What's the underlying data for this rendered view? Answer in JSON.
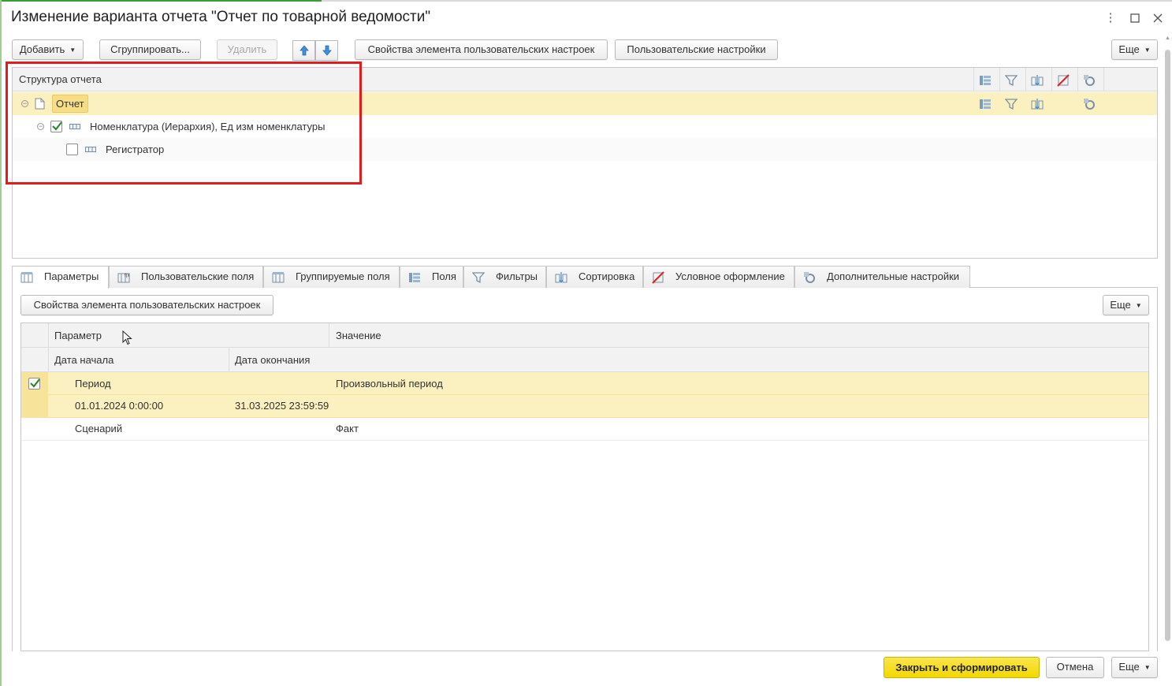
{
  "window": {
    "title": "Изменение варианта отчета \"Отчет по товарной ведомости\""
  },
  "toolbar": {
    "add_label": "Добавить",
    "group_label": "Сгруппировать...",
    "delete_label": "Удалить",
    "element_props_label": "Свойства элемента пользовательских настроек",
    "user_settings_label": "Пользовательские настройки",
    "more_label": "Еще"
  },
  "structure": {
    "header": "Структура отчета",
    "rows": [
      {
        "label": "Отчет"
      },
      {
        "label": "Номенклатура (Иерархия), Ед изм номенклатуры",
        "checked": true
      },
      {
        "label": "Регистратор",
        "checked": false
      }
    ]
  },
  "tabs": [
    {
      "label": "Параметры",
      "icon": "parameters-icon"
    },
    {
      "label": "Пользовательские поля",
      "icon": "user-fields-icon"
    },
    {
      "label": "Группируемые поля",
      "icon": "grouped-fields-icon"
    },
    {
      "label": "Поля",
      "icon": "fields-icon"
    },
    {
      "label": "Фильтры",
      "icon": "filter-icon"
    },
    {
      "label": "Сортировка",
      "icon": "sort-icon"
    },
    {
      "label": "Условное оформление",
      "icon": "conditional-format-icon"
    },
    {
      "label": "Дополнительные настройки",
      "icon": "extra-settings-icon"
    }
  ],
  "params": {
    "element_props_label": "Свойства элемента пользовательских настроек",
    "more_label": "Еще",
    "columns": {
      "parameter": "Параметр",
      "value": "Значение",
      "start_date": "Дата начала",
      "end_date": "Дата окончания"
    },
    "rows": [
      {
        "name": "Период",
        "value": "Произвольный период",
        "checked": true,
        "start": "01.01.2024 0:00:00",
        "end": "31.03.2025 23:59:59"
      },
      {
        "name": "Сценарий",
        "value": "Факт"
      }
    ]
  },
  "footer": {
    "close_and_generate_label": "Закрыть и сформировать",
    "cancel_label": "Отмена",
    "more_label": "Еще"
  },
  "colors": {
    "selection": "#faf0c0",
    "highlight_box": "#e01c1c",
    "primary_button": "#f3d800"
  }
}
